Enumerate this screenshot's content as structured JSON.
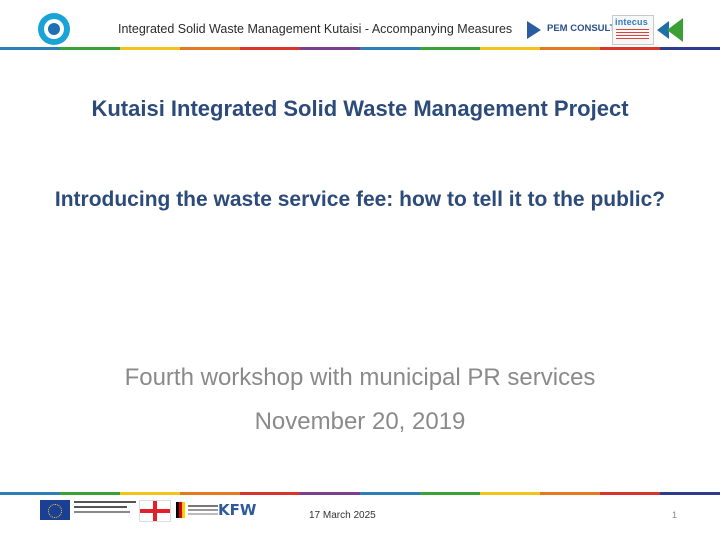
{
  "header": {
    "title": "Integrated Solid Waste Management Kutaisi - Accompanying Measures",
    "partner_logo_text": "PEM CONSULT",
    "intecus_logo_text": "intecus",
    "logo_icons": [
      "isw-kutaisi-logo-icon",
      "pem-consult-logo-icon",
      "intecus-logo-icon",
      "gc-logo-icon"
    ]
  },
  "band_colors": [
    "#2d7fb7",
    "#3aa338",
    "#f2c418",
    "#e27a21",
    "#d9342b",
    "#7a3f8f",
    "#2d7fb7",
    "#3aa338",
    "#f2c418",
    "#e27a21",
    "#d9342b",
    "#2e3b8c"
  ],
  "main": {
    "title": "Kutaisi Integrated Solid Waste Management Project",
    "subtitle": "Introducing the waste service fee: how to tell it to the public?",
    "workshop": "Fourth workshop with municipal PR services",
    "date": "November 20, 2019"
  },
  "footer": {
    "kfw_text": "KFW",
    "date": "17 March 2025",
    "slide_number": "1"
  },
  "colors": {
    "title": "#2c4b7a",
    "subtitle_text": "#8a8a8a"
  }
}
